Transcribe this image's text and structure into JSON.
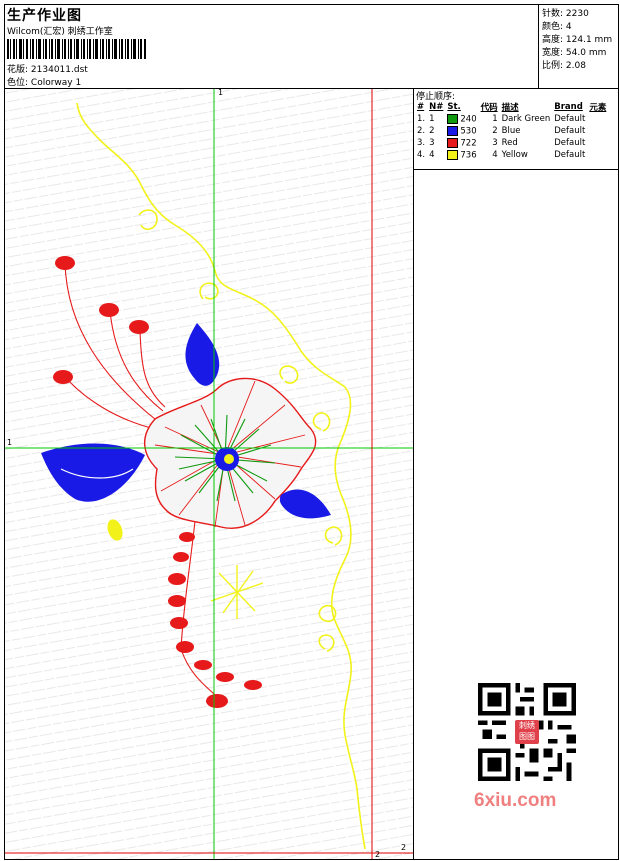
{
  "header": {
    "title": "生产作业图",
    "company": "Wilcom(汇宏) 刺绣工作室",
    "design_label": "花版:",
    "design_value": "2134011.dst",
    "colorway_label": "色位:",
    "colorway_value": "Colorway 1"
  },
  "stats": {
    "stitches": {
      "label": "针数:",
      "value": "2230"
    },
    "colors": {
      "label": "颜色:",
      "value": "4"
    },
    "height": {
      "label": "高度:",
      "value": "124.1 mm"
    },
    "width": {
      "label": "宽度:",
      "value": "54.0 mm"
    },
    "scale": {
      "label": "比例:",
      "value": "2.08"
    }
  },
  "stop_sequence": {
    "title": "停止顺序:",
    "headers": [
      "#",
      "N#",
      "St.",
      "代码",
      "描述",
      "Brand",
      "元素"
    ],
    "rows": [
      {
        "num": "1.",
        "n": "1",
        "color": "#0f9a0f",
        "st": "240",
        "code": "1",
        "desc": "Dark Green",
        "brand": "Default"
      },
      {
        "num": "2.",
        "n": "2",
        "color": "#1a1ae6",
        "st": "530",
        "code": "2",
        "desc": "Blue",
        "brand": "Default"
      },
      {
        "num": "3.",
        "n": "3",
        "color": "#e61a1a",
        "st": "722",
        "code": "3",
        "desc": "Red",
        "brand": "Default"
      },
      {
        "num": "4.",
        "n": "4",
        "color": "#f2f21a",
        "st": "736",
        "code": "4",
        "desc": "Yellow",
        "brand": "Default"
      }
    ]
  },
  "canvas": {
    "guide_labels": {
      "top": "1",
      "left": "1",
      "bottom_a": "2",
      "bottom_b": "2"
    },
    "colors": {
      "guide_green": "#00c800",
      "guide_red": "#e00000",
      "thread_green": "#0f9a0f",
      "thread_blue": "#1a1ae6",
      "thread_red": "#e61a1a",
      "thread_yellow": "#f2f21a"
    }
  },
  "watermark": {
    "text": "6xiu.com",
    "seal_text": "刺绣 图图"
  }
}
